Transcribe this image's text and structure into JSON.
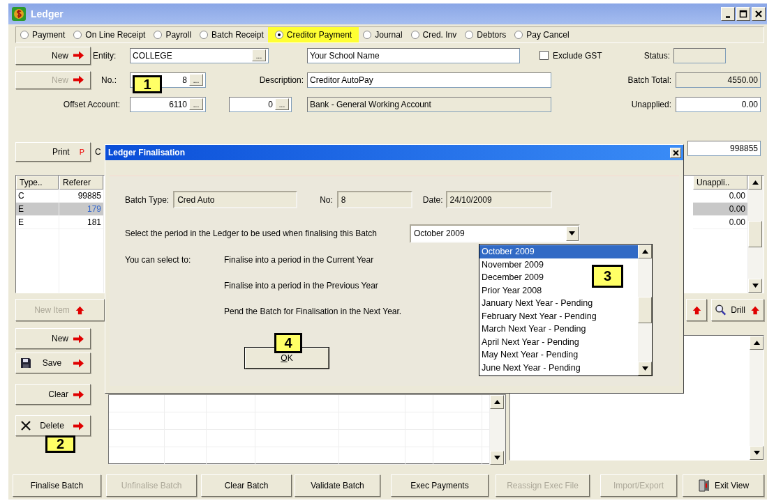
{
  "window": {
    "title": "Ledger"
  },
  "batch_types": [
    {
      "label": "Payment",
      "selected": false
    },
    {
      "label": "On Line Receipt",
      "selected": false
    },
    {
      "label": "Payroll",
      "selected": false
    },
    {
      "label": "Batch Receipt",
      "selected": false
    },
    {
      "label": "Creditor  Payment",
      "selected": true
    },
    {
      "label": "Journal",
      "selected": false
    },
    {
      "label": "Cred. Inv",
      "selected": false
    },
    {
      "label": "Debtors",
      "selected": false
    },
    {
      "label": "Pay Cancel",
      "selected": false
    }
  ],
  "header_buttons": [
    {
      "label": "New",
      "disabled": false,
      "kind": "arrow"
    },
    {
      "label": "New",
      "disabled": true,
      "kind": "arrow"
    },
    {
      "label": "Print",
      "disabled": false,
      "kind": "letter",
      "mark": "P"
    }
  ],
  "form": {
    "entity_label": "Entity:",
    "entity": {
      "value": "COLLEGE",
      "browse": "..."
    },
    "entity_name": "Your School Name",
    "exclude_gst": {
      "label": "Exclude GST",
      "checked": false
    },
    "status_label": "Status:",
    "no_label": "No.:",
    "no": {
      "value": "8",
      "browse": "..."
    },
    "description_label": "Description:",
    "description": "Creditor AutoPay",
    "batch_total_label": "Batch Total:",
    "batch_total": "4550.00",
    "offset_label": "Offset Account:",
    "offset_account": {
      "value": "6110",
      "browse": "..."
    },
    "offset_sub": {
      "value": "0",
      "browse": "..."
    },
    "offset_name": "Bank - General Working Account",
    "unapplied_label": "Unapplied:",
    "unapplied": "0.00",
    "row4_label": "C",
    "reference": "998855"
  },
  "lines": {
    "columns": [
      "Type..",
      "Referer",
      "Unappli.."
    ],
    "rows": [
      {
        "type": "C",
        "reference": "99885",
        "unapplied": "0.00",
        "selected": false
      },
      {
        "type": "E",
        "reference": "179",
        "unapplied": "0.00",
        "selected": true
      },
      {
        "type": "E",
        "reference": "181",
        "unapplied": "0.00",
        "selected": false
      }
    ]
  },
  "new_item_button": {
    "label": "New Item",
    "disabled": true
  },
  "drill_button": {
    "label": "Drill"
  },
  "item_buttons": [
    {
      "label": "New",
      "kind": "plain"
    },
    {
      "label": "Save",
      "kind": "save"
    },
    {
      "label": "Clear",
      "kind": "plain"
    },
    {
      "label": "Delete",
      "kind": "delete"
    }
  ],
  "bottom_buttons": [
    {
      "label": "Finalise Batch",
      "disabled": false,
      "kind": "plain"
    },
    {
      "label": "Unfinalise Batch",
      "disabled": true,
      "kind": "plain"
    },
    {
      "label": "Clear Batch",
      "disabled": false,
      "kind": "plain"
    },
    {
      "label": "Validate Batch",
      "disabled": false,
      "kind": "plain"
    },
    {
      "label": "Exec Payments",
      "disabled": false,
      "kind": "plain"
    },
    {
      "label": "Reassign Exec File",
      "disabled": true,
      "kind": "plain"
    },
    {
      "label": "Import/Export",
      "disabled": true,
      "kind": "plain"
    },
    {
      "label": "Exit View",
      "disabled": false,
      "kind": "exit"
    }
  ],
  "dialog": {
    "title": "Ledger Finalisation",
    "batch_type_label": "Batch Type:",
    "batch_type": "Cred Auto",
    "no_label": "No:",
    "no": "8",
    "date_label": "Date:",
    "date": "24/10/2009",
    "period_prompt": "Select the period in the Ledger to be used when finalising this Batch",
    "period": "October 2009",
    "options_label": "You can select to:",
    "options": [
      "Finalise into a period in the Current Year",
      "Finalise into a period in the Previous Year",
      "Pend the Batch for Finalisation in the Next Year."
    ],
    "ok_label": "OK"
  },
  "period_list": [
    {
      "label": "October 2009",
      "selected": true
    },
    {
      "label": "November 2009",
      "selected": false
    },
    {
      "label": "December 2009",
      "selected": false
    },
    {
      "label": "Prior Year 2008",
      "selected": false
    },
    {
      "label": "January Next Year - Pending",
      "selected": false
    },
    {
      "label": "February Next Year - Pending",
      "selected": false
    },
    {
      "label": "March Next Year - Pending",
      "selected": false
    },
    {
      "label": "April Next Year - Pending",
      "selected": false
    },
    {
      "label": "May Next Year - Pending",
      "selected": false
    },
    {
      "label": "June Next Year - Pending",
      "selected": false
    }
  ],
  "callouts": [
    "1",
    "2",
    "3",
    "4"
  ]
}
